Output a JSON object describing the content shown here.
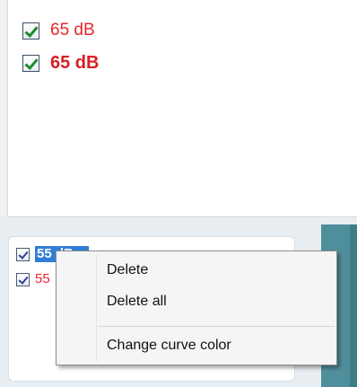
{
  "top_list": {
    "items": [
      {
        "label": "65 dB",
        "checked": true,
        "style": "normal"
      },
      {
        "label": "65 dB",
        "checked": true,
        "style": "bold"
      }
    ]
  },
  "lower_list": {
    "items": [
      {
        "label": "55 dB",
        "checked": true,
        "selected": true
      },
      {
        "label": "55",
        "checked": true,
        "selected": false
      }
    ]
  },
  "context_menu": {
    "delete": "Delete",
    "delete_all": "Delete all",
    "change_curve_color": "Change curve color"
  },
  "colors": {
    "curve_red": "#e8262b",
    "selection_blue": "#2f7fd6",
    "check_green": "#1f8a2f",
    "teal": "#4f8f9b"
  },
  "icons": {
    "checkbox_checked_green": "check-icon",
    "checkbox_checked_blue": "check-icon"
  }
}
